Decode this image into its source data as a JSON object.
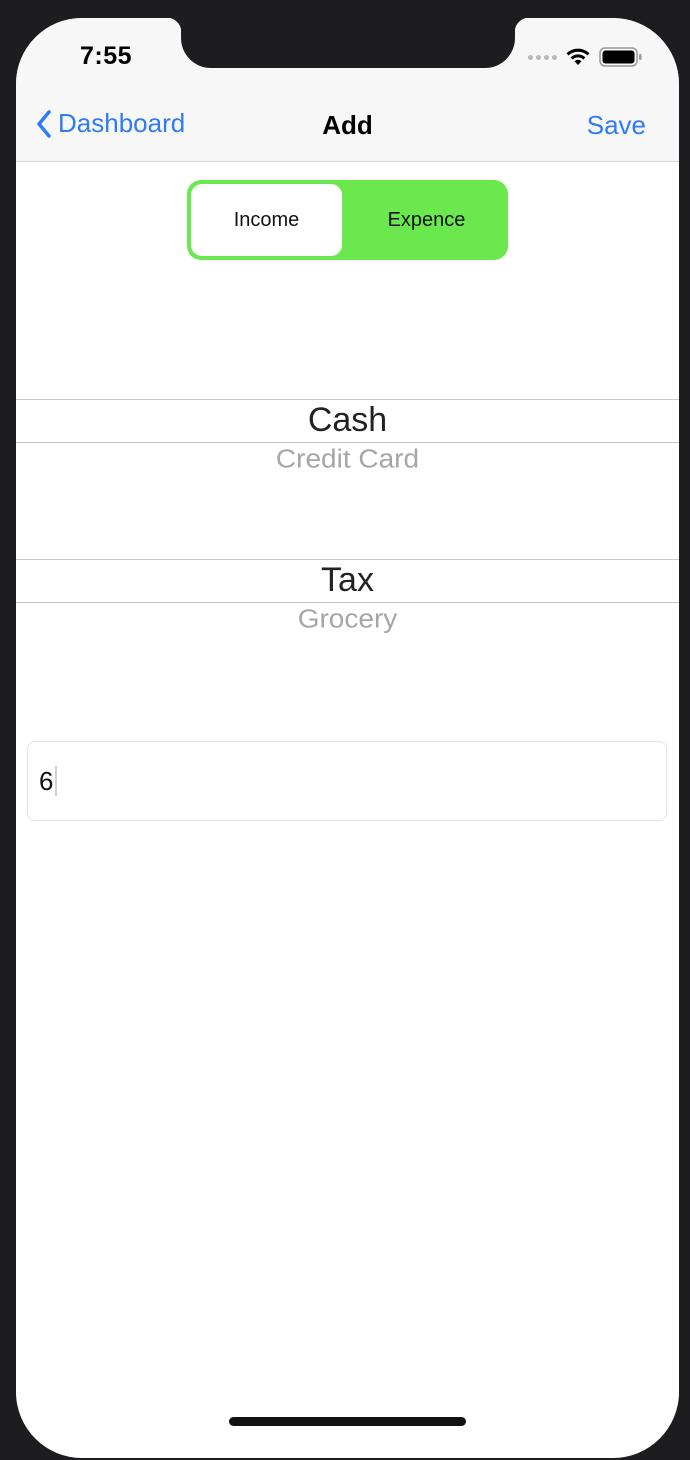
{
  "status_bar": {
    "time": "7:55",
    "icons": [
      "signal-dots-icon",
      "wifi-icon",
      "battery-icon"
    ]
  },
  "nav": {
    "back_label": "Dashboard",
    "title": "Add",
    "save_label": "Save"
  },
  "segmented_control": {
    "options": [
      "Income",
      "Expence"
    ],
    "selected": "Expence",
    "accent_color": "#6be84e"
  },
  "account_picker": {
    "selected": "Cash",
    "next": "Credit Card"
  },
  "category_picker": {
    "selected": "Tax",
    "next": "Grocery"
  },
  "amount_field": {
    "value": "6"
  },
  "colors": {
    "link": "#2f7bf5",
    "device_frame": "#1d1d1f"
  }
}
